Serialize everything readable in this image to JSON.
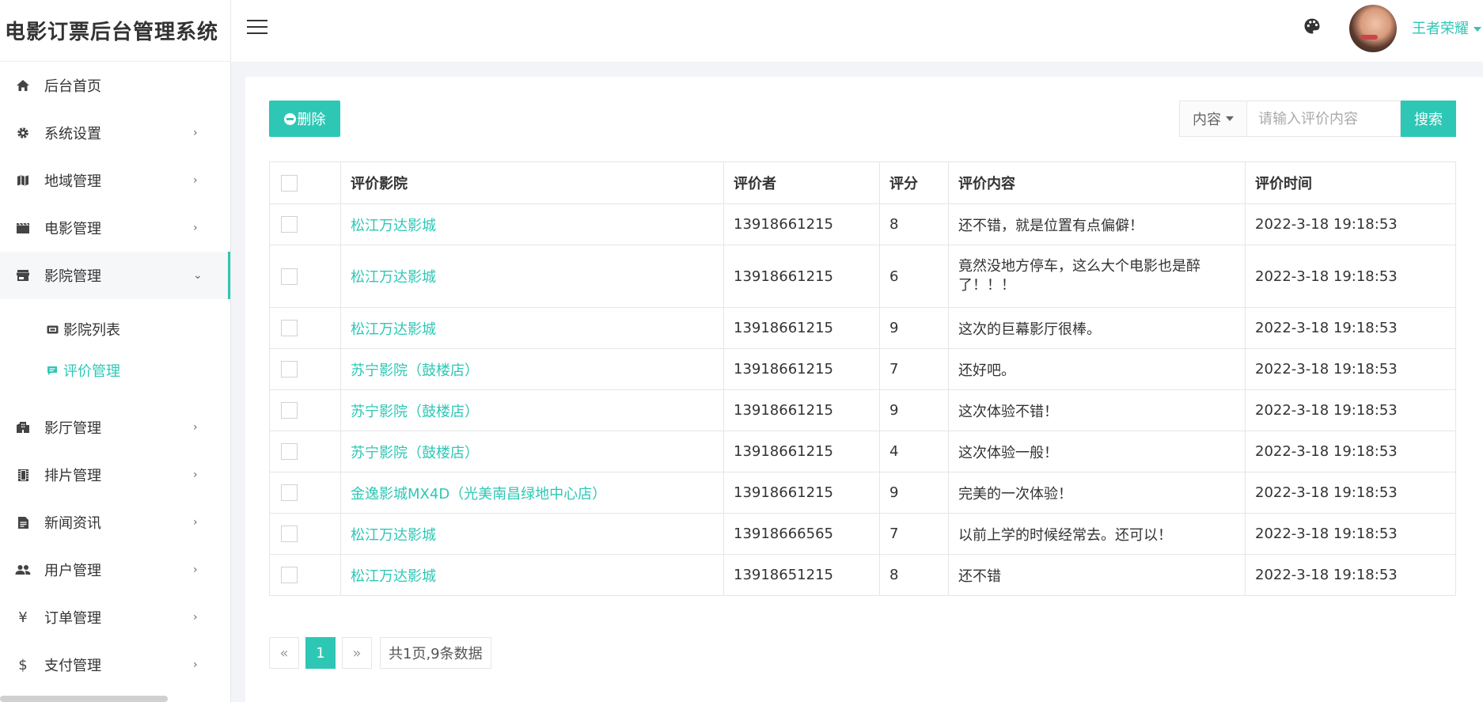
{
  "app": {
    "title": "电影订票后台管理系统"
  },
  "colors": {
    "accent": "#2ec7b5",
    "time": "#1fb55a"
  },
  "sidebar": {
    "items": [
      {
        "label": "后台首页",
        "icon": "home-icon",
        "has_chevron": false
      },
      {
        "label": "系统设置",
        "icon": "gear-icon",
        "has_chevron": true
      },
      {
        "label": "地域管理",
        "icon": "map-icon",
        "has_chevron": true
      },
      {
        "label": "电影管理",
        "icon": "film-clapper-icon",
        "has_chevron": true
      },
      {
        "label": "影院管理",
        "icon": "store-icon",
        "has_chevron": true,
        "expanded": true,
        "children": [
          {
            "label": "影院列表",
            "icon": "ticket-icon",
            "active": false
          },
          {
            "label": "评价管理",
            "icon": "comment-icon",
            "active": true
          }
        ]
      },
      {
        "label": "影厅管理",
        "icon": "building-icon",
        "has_chevron": true
      },
      {
        "label": "排片管理",
        "icon": "film-strip-icon",
        "has_chevron": true
      },
      {
        "label": "新闻资讯",
        "icon": "document-icon",
        "has_chevron": true
      },
      {
        "label": "用户管理",
        "icon": "users-icon",
        "has_chevron": true
      },
      {
        "label": "订单管理",
        "icon": "yen-icon",
        "has_chevron": true
      },
      {
        "label": "支付管理",
        "icon": "dollar-icon",
        "has_chevron": true
      }
    ]
  },
  "header": {
    "menu_icon": "hamburger-menu-icon",
    "theme_icon": "palette-icon",
    "user_name": "王者荣耀"
  },
  "toolbar": {
    "delete_label": "删除",
    "search_field": "内容",
    "search_placeholder": "请输入评价内容",
    "search_label": "搜索"
  },
  "table": {
    "columns": [
      "评价影院",
      "评价者",
      "评分",
      "评价内容",
      "评价时间"
    ],
    "rows": [
      {
        "cinema": "松江万达影城",
        "user": "13918661215",
        "score": "8",
        "content": "还不错，就是位置有点偏僻！",
        "time": "2022-3-18 19:18:53"
      },
      {
        "cinema": "松江万达影城",
        "user": "13918661215",
        "score": "6",
        "content": "竟然没地方停车，这么大个电影也是醉了！！！",
        "time": "2022-3-18 19:18:53"
      },
      {
        "cinema": "松江万达影城",
        "user": "13918661215",
        "score": "9",
        "content": "这次的巨幕影厅很棒。",
        "time": "2022-3-18 19:18:53"
      },
      {
        "cinema": "苏宁影院（鼓楼店）",
        "user": "13918661215",
        "score": "7",
        "content": "还好吧。",
        "time": "2022-3-18 19:18:53"
      },
      {
        "cinema": "苏宁影院（鼓楼店）",
        "user": "13918661215",
        "score": "9",
        "content": "这次体验不错！",
        "time": "2022-3-18 19:18:53"
      },
      {
        "cinema": "苏宁影院（鼓楼店）",
        "user": "13918661215",
        "score": "4",
        "content": "这次体验一般！",
        "time": "2022-3-18 19:18:53"
      },
      {
        "cinema": "金逸影城MX4D（光美南昌绿地中心店）",
        "user": "13918661215",
        "score": "9",
        "content": "完美的一次体验！",
        "time": "2022-3-18 19:18:53"
      },
      {
        "cinema": "松江万达影城",
        "user": "13918666565",
        "score": "7",
        "content": "以前上学的时候经常去。还可以！",
        "time": "2022-3-18 19:18:53"
      },
      {
        "cinema": "松江万达影城",
        "user": "13918651215",
        "score": "8",
        "content": "还不错",
        "time": "2022-3-18 19:18:53"
      }
    ]
  },
  "pagination": {
    "prev": "«",
    "current": "1",
    "next": "»",
    "info": "共1页,9条数据"
  }
}
